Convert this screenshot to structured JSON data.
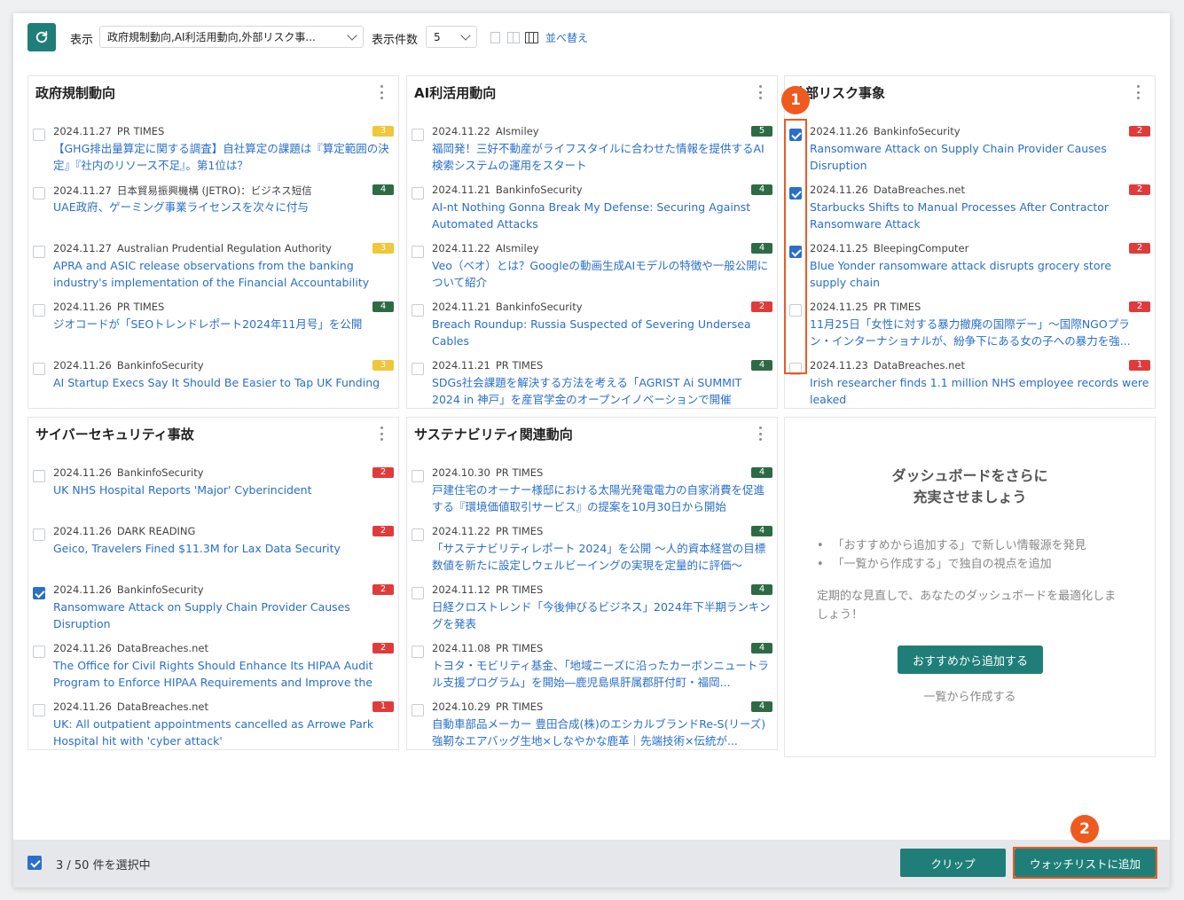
{
  "toolbar": {
    "display_label": "表示",
    "display_value": "政府規制動向,AI利活用動向,外部リスク事...",
    "count_label": "表示件数",
    "count_value": "5",
    "sort_link": "並べ替え"
  },
  "panels": [
    {
      "title": "政府規制動向",
      "items": [
        {
          "date": "2024.11.27",
          "source": "PR TIMES",
          "badge": "3",
          "badge_color": "yellow",
          "checked": false,
          "title": "【GHG排出量算定に関する調査】自社算定の課題は『算定範囲の決定』『社内のリソース不足』。第1位は？"
        },
        {
          "date": "2024.11.27",
          "source": "日本貿易振興機構 (JETRO)：ビジネス短信",
          "badge": "4",
          "badge_color": "green",
          "checked": false,
          "title": "UAE政府、ゲーミング事業ライセンスを次々に付与"
        },
        {
          "date": "2024.11.27",
          "source": "Australian Prudential Regulation Authority",
          "badge": "3",
          "badge_color": "yellow",
          "checked": false,
          "title": "APRA and ASIC release observations from the banking industry's implementation of the Financial Accountability Regime | APRA"
        },
        {
          "date": "2024.11.26",
          "source": "PR TIMES",
          "badge": "4",
          "badge_color": "green",
          "checked": false,
          "title": "ジオコードが「SEOトレンドレポート2024年11月号」を公開"
        },
        {
          "date": "2024.11.26",
          "source": "BankinfoSecurity",
          "badge": "3",
          "badge_color": "yellow",
          "checked": false,
          "title": "AI Startup Execs Say It Should Be Easier to Tap UK Funding"
        }
      ]
    },
    {
      "title": "AI利活用動向",
      "items": [
        {
          "date": "2024.11.22",
          "source": "AIsmiley",
          "badge": "5",
          "badge_color": "green",
          "checked": false,
          "title": "福岡発！三好不動産がライフスタイルに合わせた情報を提供するAI検索システムの運用をスタート"
        },
        {
          "date": "2024.11.21",
          "source": "BankinfoSecurity",
          "badge": "4",
          "badge_color": "green",
          "checked": false,
          "title": "AI-nt Nothing Gonna Break My Defense: Securing Against Automated Attacks"
        },
        {
          "date": "2024.11.22",
          "source": "AIsmiley",
          "badge": "4",
          "badge_color": "green",
          "checked": false,
          "title": "Veo（ベオ）とは？Googleの動画生成AIモデルの特徴や一般公開について紹介"
        },
        {
          "date": "2024.11.21",
          "source": "BankinfoSecurity",
          "badge": "2",
          "badge_color": "red",
          "checked": false,
          "title": "Breach Roundup: Russia Suspected of Severing Undersea Cables"
        },
        {
          "date": "2024.11.21",
          "source": "PR TIMES",
          "badge": "4",
          "badge_color": "green",
          "checked": false,
          "title": "SDGs社会課題を解決する方法を考える「AGRIST Ai SUMMIT 2024 in 神戸」を産官学金のオープンイノベーションで開催"
        }
      ]
    },
    {
      "title": "外部リスク事象",
      "items": [
        {
          "date": "2024.11.26",
          "source": "BankinfoSecurity",
          "badge": "2",
          "badge_color": "red",
          "checked": true,
          "title": "Ransomware Attack on Supply Chain Provider Causes Disruption"
        },
        {
          "date": "2024.11.26",
          "source": "DataBreaches.net",
          "badge": "2",
          "badge_color": "red",
          "checked": true,
          "title": "Starbucks Shifts to Manual Processes After Contractor Ransomware Attack"
        },
        {
          "date": "2024.11.25",
          "source": "BleepingComputer",
          "badge": "2",
          "badge_color": "red",
          "checked": true,
          "title": "Blue Yonder ransomware attack disrupts grocery store supply chain"
        },
        {
          "date": "2024.11.25",
          "source": "PR TIMES",
          "badge": "2",
          "badge_color": "red",
          "checked": false,
          "title": "11月25日「女性に対する暴力撤廃の国際デー」〜国際NGOプラン・インターナショナルが、紛争下にある女の子への暴力を強..."
        },
        {
          "date": "2024.11.23",
          "source": "DataBreaches.net",
          "badge": "1",
          "badge_color": "red",
          "checked": false,
          "title": "Irish researcher finds 1.1 million NHS employee records were leaked"
        }
      ]
    },
    {
      "title": "サイバーセキュリティ事故",
      "items": [
        {
          "date": "2024.11.26",
          "source": "BankinfoSecurity",
          "badge": "2",
          "badge_color": "red",
          "checked": false,
          "title": "UK NHS Hospital Reports 'Major' Cyberincident"
        },
        {
          "date": "2024.11.26",
          "source": "DARK READING",
          "badge": "2",
          "badge_color": "red",
          "checked": false,
          "title": "Geico, Travelers Fined $11.3M for Lax Data Security"
        },
        {
          "date": "2024.11.26",
          "source": "BankinfoSecurity",
          "badge": "2",
          "badge_color": "red",
          "checked": true,
          "title": "Ransomware Attack on Supply Chain Provider Causes Disruption"
        },
        {
          "date": "2024.11.26",
          "source": "DataBreaches.net",
          "badge": "2",
          "badge_color": "red",
          "checked": false,
          "title": "The Office for Civil Rights Should Enhance Its HIPAA Audit Program to Enforce HIPAA Requirements and Improve the Protection of..."
        },
        {
          "date": "2024.11.26",
          "source": "DataBreaches.net",
          "badge": "1",
          "badge_color": "red",
          "checked": false,
          "title": "UK: All outpatient appointments cancelled as Arrowe Park Hospital hit with 'cyber attack'"
        }
      ]
    },
    {
      "title": "サステナビリティ関連動向",
      "items": [
        {
          "date": "2024.10.30",
          "source": "PR TIMES",
          "badge": "4",
          "badge_color": "green",
          "checked": false,
          "title": "戸建住宅のオーナー様邸における太陽光発電電力の自家消費を促進する『環境価値取引サービス』の提案を10月30日から開始"
        },
        {
          "date": "2024.11.22",
          "source": "PR TIMES",
          "badge": "4",
          "badge_color": "green",
          "checked": false,
          "title": "「サステナビリティレポート 2024」を公開 〜人的資本経営の目標数値を新たに設定しウェルビーイングの実現を定量的に評価〜"
        },
        {
          "date": "2024.11.12",
          "source": "PR TIMES",
          "badge": "4",
          "badge_color": "green",
          "checked": false,
          "title": "日経クロストレンド「今後伸びるビジネス」2024年下半期ランキングを発表"
        },
        {
          "date": "2024.11.08",
          "source": "PR TIMES",
          "badge": "4",
          "badge_color": "green",
          "checked": false,
          "title": "トヨタ・モビリティ基金、「地域ニーズに沿ったカーボンニュートラル支援プログラム」を開始―鹿児島県肝属郡肝付町・福岡..."
        },
        {
          "date": "2024.10.29",
          "source": "PR TIMES",
          "badge": "4",
          "badge_color": "green",
          "checked": false,
          "title": "自動車部品メーカー 豊田合成(株)のエシカルブランドRe-S(リーズ) 強靭なエアバッグ生地×しなやかな鹿革｜先端技術×伝統が..."
        }
      ]
    }
  ],
  "promo": {
    "title_line1": "ダッシュボードをさらに",
    "title_line2": "充実させましょう",
    "bullet1": "「おすすめから追加する」で新しい情報源を発見",
    "bullet2": "「一覧から作成する」で独自の視点を追加",
    "text": "定期的な見直しで、あなたのダッシュボードを最適化しましょう！",
    "button": "おすすめから追加する",
    "link": "一覧から作成する"
  },
  "footer": {
    "selection_text": "3 / 50 件を選択中",
    "clip_button": "クリップ",
    "watchlist_button": "ウォッチリストに追加"
  },
  "annotations": {
    "marker1": "1",
    "marker2": "2"
  },
  "colors": {
    "accent": "#1f7f78",
    "link": "#2a6fc9",
    "highlight": "#ee5a1f",
    "badge_green": "#2e6b45",
    "badge_red": "#e03b3b",
    "badge_yellow": "#f0c63a"
  }
}
